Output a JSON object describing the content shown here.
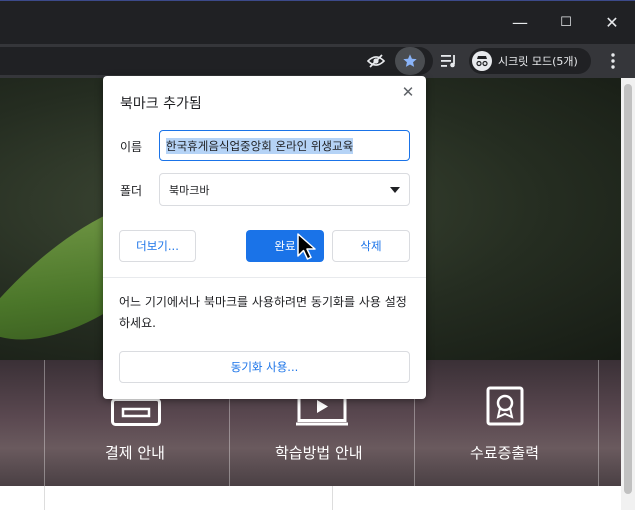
{
  "window_controls": {
    "minimize_glyph": "—",
    "maximize_glyph": "☐",
    "close_glyph": "✕"
  },
  "toolbar": {
    "incognito_label": "시크릿 모드(5개)"
  },
  "bookmark_dialog": {
    "title": "북마크 추가됨",
    "close_glyph": "✕",
    "name_label": "이름",
    "name_value": "한국휴게음식업중앙회 온라인 위생교육",
    "folder_label": "폴더",
    "folder_value": "북마크바",
    "more_button": "더보기...",
    "done_button": "완료",
    "remove_button": "삭제",
    "sync_message": "어느 기기에서나 북마크를 사용하려면 동기화를 사용 설정하세요.",
    "sync_button": "동기화 사용..."
  },
  "page": {
    "menu": [
      {
        "label": "결제 안내"
      },
      {
        "label": "학습방법 안내"
      },
      {
        "label": "수료증출력"
      }
    ]
  },
  "colors": {
    "accent": "#1a73e8",
    "star_active": "#8ab4f8",
    "chrome_dark": "#202124",
    "toolbar": "#35363a"
  }
}
